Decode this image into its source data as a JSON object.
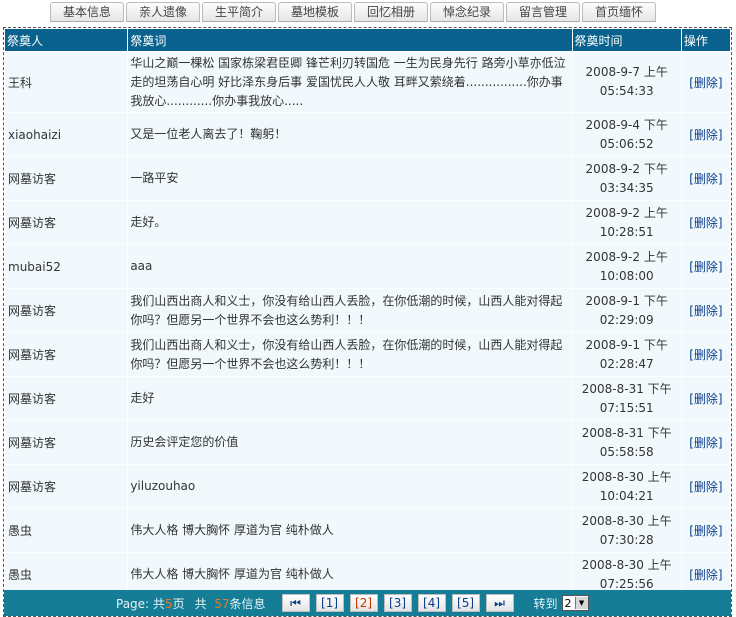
{
  "tabs": [
    "基本信息",
    "亲人遗像",
    "生平简介",
    "墓地模板",
    "回忆相册",
    "悼念纪录",
    "留言管理",
    "首页缅怀"
  ],
  "table": {
    "headers": [
      "祭奠人",
      "祭奠词",
      "祭奠时间",
      "操作"
    ],
    "delete_label": "[删除]",
    "rows": [
      {
        "name": "王科",
        "msg": "华山之巅一棵松  国家栋梁君臣卿  锋芒利刃转国危  一生为民身先行  路旁小草亦低泣  走的坦荡自心明  好比泽东身后事  爱国忧民人人敬  耳畔又萦绕着................你办事我放心............你办事我放心.....",
        "date": "2008-9-7 上午",
        "clock": "05:54:33"
      },
      {
        "name": "xiaohaizi",
        "msg": "又是一位老人离去了！鞠躬！",
        "date": "2008-9-4 下午",
        "clock": "05:06:52"
      },
      {
        "name": "网墓访客",
        "msg": "一路平安",
        "date": "2008-9-2 下午",
        "clock": "03:34:35"
      },
      {
        "name": "网墓访客",
        "msg": "走好。",
        "date": "2008-9-2 上午",
        "clock": "10:28:51"
      },
      {
        "name": "mubai52",
        "msg": "aaa",
        "date": "2008-9-2 上午",
        "clock": "10:08:00"
      },
      {
        "name": "网墓访客",
        "msg": "我们山西出商人和义士，你没有给山西人丢脸，在你低潮的时候，山西人能对得起你吗？但愿另一个世界不会也这么势利！！！",
        "date": "2008-9-1 下午",
        "clock": "02:29:09"
      },
      {
        "name": "网墓访客",
        "msg": "我们山西出商人和义士，你没有给山西人丢脸，在你低潮的时候，山西人能对得起你吗？但愿另一个世界不会也这么势利！！！",
        "date": "2008-9-1 下午",
        "clock": "02:28:47"
      },
      {
        "name": "网墓访客",
        "msg": "走好",
        "date": "2008-8-31 下午",
        "clock": "07:15:51"
      },
      {
        "name": "网墓访客",
        "msg": "历史会评定您的价值",
        "date": "2008-8-31 下午",
        "clock": "05:58:58"
      },
      {
        "name": "网墓访客",
        "msg": "yiluzouhao",
        "date": "2008-8-30 上午",
        "clock": "10:04:21"
      },
      {
        "name": "愚虫",
        "msg": "伟大人格  博大胸怀  厚道为官  纯朴做人",
        "date": "2008-8-30 上午",
        "clock": "07:30:28"
      },
      {
        "name": "愚虫",
        "msg": "伟大人格  博大胸怀  厚道为官  纯朴做人",
        "date": "2008-8-30 上午",
        "clock": "07:25:56"
      }
    ]
  },
  "pagination": {
    "prefix": "Page: 共",
    "total_pages": "5",
    "pages_suffix": "页",
    "mid": "共",
    "total_items": "57",
    "items_suffix": "条信息",
    "first_label": "⏮",
    "last_label": "⏭",
    "pages": [
      "[1]",
      "[2]",
      "[3]",
      "[4]",
      "[5]"
    ],
    "current_index": 1,
    "goto_label": "转到",
    "goto_value": "2"
  }
}
